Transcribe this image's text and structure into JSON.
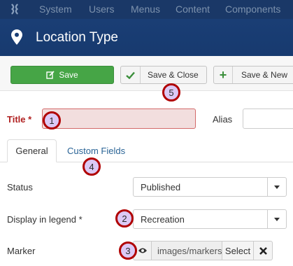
{
  "topnav": {
    "items": [
      "System",
      "Users",
      "Menus",
      "Content",
      "Components"
    ]
  },
  "header": {
    "title": "Location Type"
  },
  "toolbar": {
    "save_label": "Save",
    "save_close_label": "Save & Close",
    "save_new_label": "Save & New"
  },
  "form": {
    "title_label": "Title *",
    "title_value": "",
    "alias_label": "Alias",
    "alias_value": ""
  },
  "tabs": [
    {
      "label": "General",
      "active": true
    },
    {
      "label": "Custom Fields",
      "active": false
    }
  ],
  "fields": {
    "status_label": "Status",
    "status_value": "Published",
    "legend_label": "Display in legend *",
    "legend_value": "Recreation",
    "marker_label": "Marker",
    "marker_path": "images/markers",
    "marker_select_label": "Select"
  },
  "callouts": [
    "1",
    "2",
    "3",
    "4",
    "5"
  ],
  "colors": {
    "topbar": "#1a3867",
    "header": "#1a3e75",
    "save_green": "#46a546",
    "required_red": "#b02020",
    "callout_border": "#b00000",
    "callout_fill": "#dcc9f5",
    "link_blue": "#2a6496"
  },
  "icons": {
    "logo": "joomla-logo-icon",
    "header": "map-pin-icon",
    "save": "edit-icon",
    "save_close": "check-icon",
    "save_new": "plus-icon",
    "preview": "eye-icon",
    "clear": "close-icon"
  }
}
